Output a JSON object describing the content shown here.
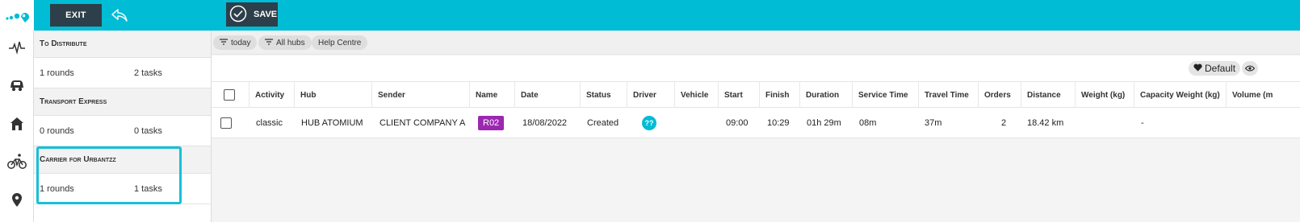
{
  "topbar": {
    "exit_label": "EXIT",
    "save_label": "SAVE",
    "accent_color": "#00bcd4",
    "button_color": "#2d3f4a"
  },
  "sidebar": {
    "icons": [
      "logo-icon",
      "activity-icon",
      "vehicle-icon",
      "home-icon",
      "bicycle-icon",
      "location-pin-icon"
    ]
  },
  "panel": {
    "sections": [
      {
        "title": "To Distribute",
        "rounds": "1 rounds",
        "tasks": "2 tasks"
      },
      {
        "title": "Transport Express",
        "rounds": "0 rounds",
        "tasks": "0 tasks"
      },
      {
        "title": "Carrier for Urbantzz",
        "rounds": "1 rounds",
        "tasks": "1 tasks"
      }
    ]
  },
  "filters": {
    "today": "today",
    "hubs": "All hubs",
    "help": "Help Centre"
  },
  "view": {
    "default_label": "Default"
  },
  "table": {
    "columns": [
      "",
      "Activity",
      "Hub",
      "Sender",
      "Name",
      "Date",
      "Status",
      "Driver",
      "Vehicle",
      "Start",
      "Finish",
      "Duration",
      "Service Time",
      "Travel Time",
      "Orders",
      "Distance",
      "Weight (kg)",
      "Capacity Weight (kg)",
      "Volume (m"
    ],
    "row": {
      "activity": "classic",
      "hub": "HUB ATOMIUM",
      "sender": "CLIENT COMPANY A",
      "name": "R02",
      "date": "18/08/2022",
      "status": "Created",
      "driver": "??",
      "vehicle": "",
      "start": "09:00",
      "finish": "10:29",
      "duration": "01h 29m",
      "service_time": "08m",
      "travel_time": "37m",
      "orders": "2",
      "distance": "18.42 km",
      "weight": "",
      "capacity_weight": "-"
    },
    "name_badge_color": "#9c27b0",
    "driver_badge_color": "#00bcd4"
  }
}
